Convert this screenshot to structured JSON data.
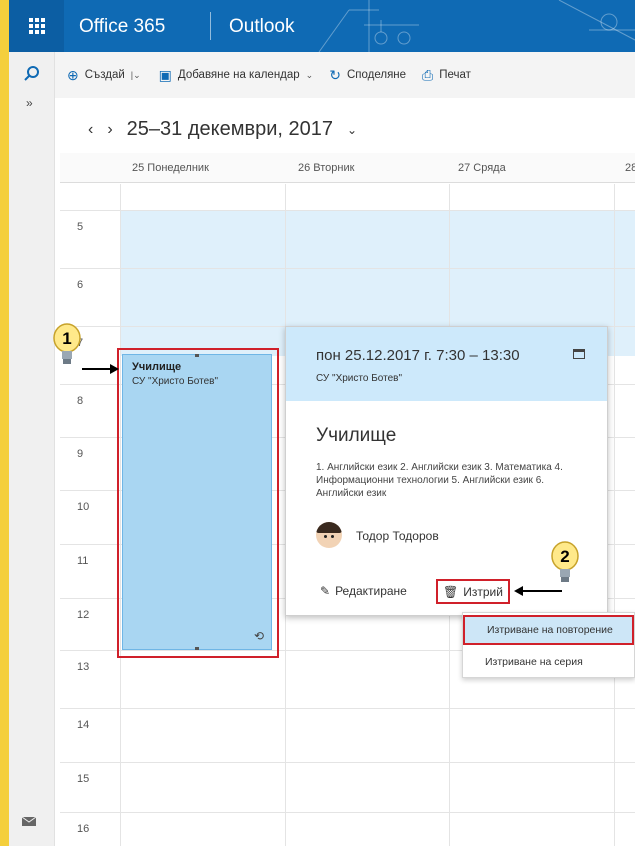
{
  "header": {
    "brand": "Office 365",
    "app_name": "Outlook"
  },
  "toolbar": {
    "create": "Създай",
    "add_calendar": "Добавяне на календар",
    "share": "Споделяне",
    "print": "Печат"
  },
  "date_range": "25–31 декември, 2017",
  "days": [
    "25 Понеделник",
    "26 Вторник",
    "27 Сряда",
    "28"
  ],
  "hours": [
    "5",
    "6",
    "7",
    "8",
    "9",
    "10",
    "11",
    "12",
    "13",
    "14",
    "15",
    "16"
  ],
  "event": {
    "title": "Училище",
    "location": "СУ \"Христо Ботев\""
  },
  "callout": {
    "time": "пон 25.12.2017 г. 7:30 – 13:30",
    "location": "СУ \"Христо Ботев\"",
    "subject": "Училище",
    "description": "1. Английски език 2. Английски език 3. Математика 4. Информационни технологии 5. Английски език 6. Английски език",
    "organizer": "Тодор Тодоров",
    "edit_label": "Редактиране",
    "delete_label": "Изтрий"
  },
  "delete_menu": {
    "occurrence": "Изтриване на повторение",
    "series": "Изтриване на серия"
  },
  "annotations": {
    "marker_1": "1",
    "marker_2": "2"
  },
  "colors": {
    "header": "#0f6ab4",
    "event_fill": "#a9d6f2",
    "highlight": "#d0202a",
    "left_strip": "#f4cf3c"
  }
}
